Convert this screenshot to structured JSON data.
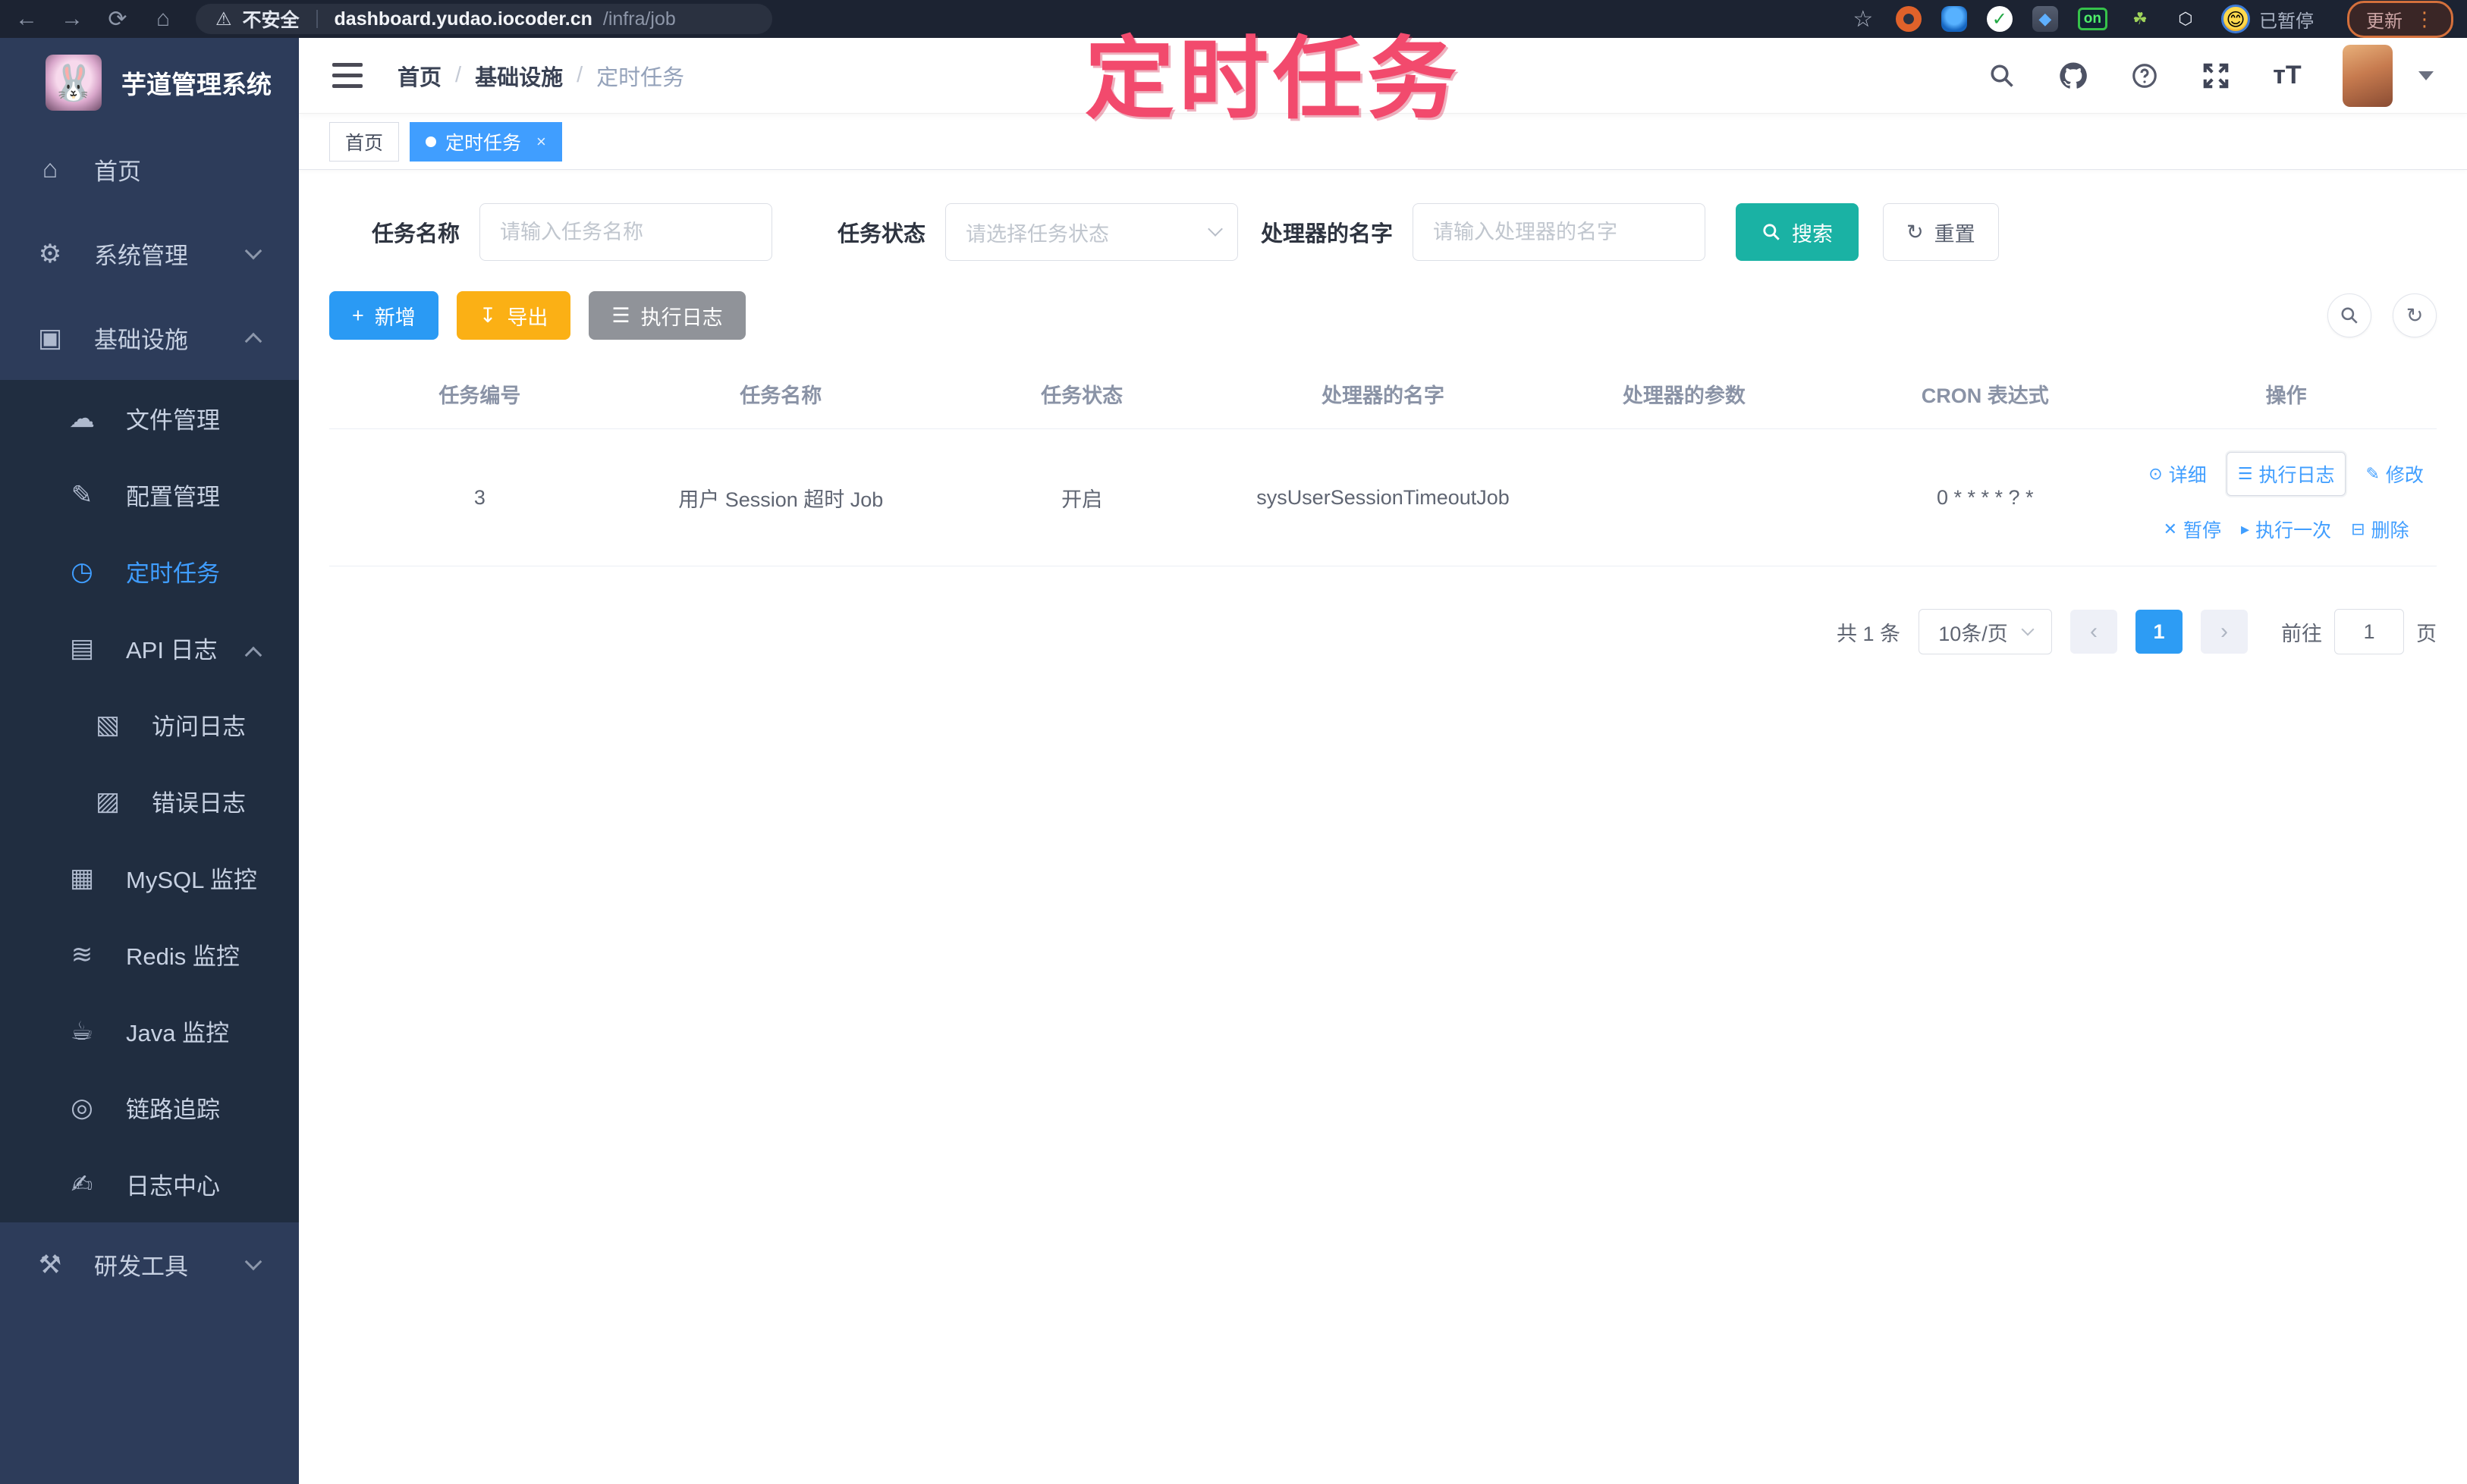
{
  "browser": {
    "security_label": "不安全",
    "url_host": "dashboard.yudao.iocoder.cn",
    "url_path": "/infra/job",
    "on_badge": "on",
    "paused_label": "已暂停",
    "update_label": "更新"
  },
  "annotation": {
    "text": "定时任务",
    "color": "#f24a6d"
  },
  "sidebar": {
    "logo_title": "芋道管理系统",
    "items": [
      {
        "label": "首页",
        "icon": "home-icon",
        "glyph": "⌂"
      },
      {
        "label": "系统管理",
        "icon": "gear-icon",
        "glyph": "⚙"
      },
      {
        "label": "基础设施",
        "icon": "monitor-icon",
        "glyph": "▣"
      },
      {
        "label": "文件管理",
        "icon": "cloud-upload-icon",
        "glyph": "☁"
      },
      {
        "label": "配置管理",
        "icon": "edit-square-icon",
        "glyph": "✎"
      },
      {
        "label": "定时任务",
        "icon": "timer-icon",
        "glyph": "◷"
      },
      {
        "label": "API 日志",
        "icon": "api-log-icon",
        "glyph": "▤"
      },
      {
        "label": "访问日志",
        "icon": "access-log-icon",
        "glyph": "▧"
      },
      {
        "label": "错误日志",
        "icon": "error-log-icon",
        "glyph": "▨"
      },
      {
        "label": "MySQL 监控",
        "icon": "database-icon",
        "glyph": "▦"
      },
      {
        "label": "Redis 监控",
        "icon": "layers-icon",
        "glyph": "≋"
      },
      {
        "label": "Java 监控",
        "icon": "java-monitor-icon",
        "glyph": "☕"
      },
      {
        "label": "链路追踪",
        "icon": "trace-eye-icon",
        "glyph": "◎"
      },
      {
        "label": "日志中心",
        "icon": "log-center-icon",
        "glyph": "✍"
      },
      {
        "label": "研发工具",
        "icon": "toolbox-icon",
        "glyph": "⚒"
      }
    ]
  },
  "header": {
    "breadcrumb": [
      "首页",
      "基础设施",
      "定时任务"
    ],
    "separator": "/"
  },
  "tabs": [
    {
      "label": "首页"
    },
    {
      "label": "定时任务",
      "close": "×"
    }
  ],
  "filters": {
    "name_label": "任务名称",
    "name_placeholder": "请输入任务名称",
    "status_label": "任务状态",
    "status_placeholder": "请选择任务状态",
    "handler_label": "处理器的名字",
    "handler_placeholder": "请输入处理器的名字",
    "search_label": "搜索",
    "reset_label": "重置",
    "reset_glyph": "↻"
  },
  "toolbar": {
    "add_label": "新增",
    "add_glyph": "+",
    "export_label": "导出",
    "export_glyph": "↧",
    "job_log_label": "执行日志",
    "job_log_glyph": "☰",
    "search_toggle_glyph": "🔍",
    "refresh_glyph": "↻"
  },
  "table": {
    "columns": [
      "任务编号",
      "任务名称",
      "任务状态",
      "处理器的名字",
      "处理器的参数",
      "CRON 表达式",
      "操作"
    ],
    "row": {
      "id": "3",
      "name": "用户 Session 超时 Job",
      "status": "开启",
      "handler": "sysUserSessionTimeoutJob",
      "param": "",
      "cron": "0 * * * * ? *"
    },
    "actions": {
      "detail": "详细",
      "detail_glyph": "⊙",
      "job_log": "执行日志",
      "job_log_glyph": "☰",
      "edit": "修改",
      "edit_glyph": "✎",
      "pause": "暂停",
      "pause_glyph": "✕",
      "run_once": "执行一次",
      "run_once_glyph": "▸",
      "delete": "删除",
      "delete_glyph": "⊟"
    }
  },
  "pagination": {
    "total_label": "共 1 条",
    "page_size": "10条/页",
    "prev_glyph": "‹",
    "next_glyph": "›",
    "current_page": "1",
    "goto_label": "前往",
    "goto_value": "1",
    "page_unit": "页"
  },
  "palette": {
    "accent_blue": "#409eff",
    "search_teal": "#1ab2a4",
    "export_yellow": "#fbb015",
    "gray_button": "#909399",
    "sidebar_bg": "#2d3c5a",
    "submenu_bg": "#202d40",
    "browser_bg": "#1c2332",
    "annotation_pink": "#f24a6d"
  }
}
